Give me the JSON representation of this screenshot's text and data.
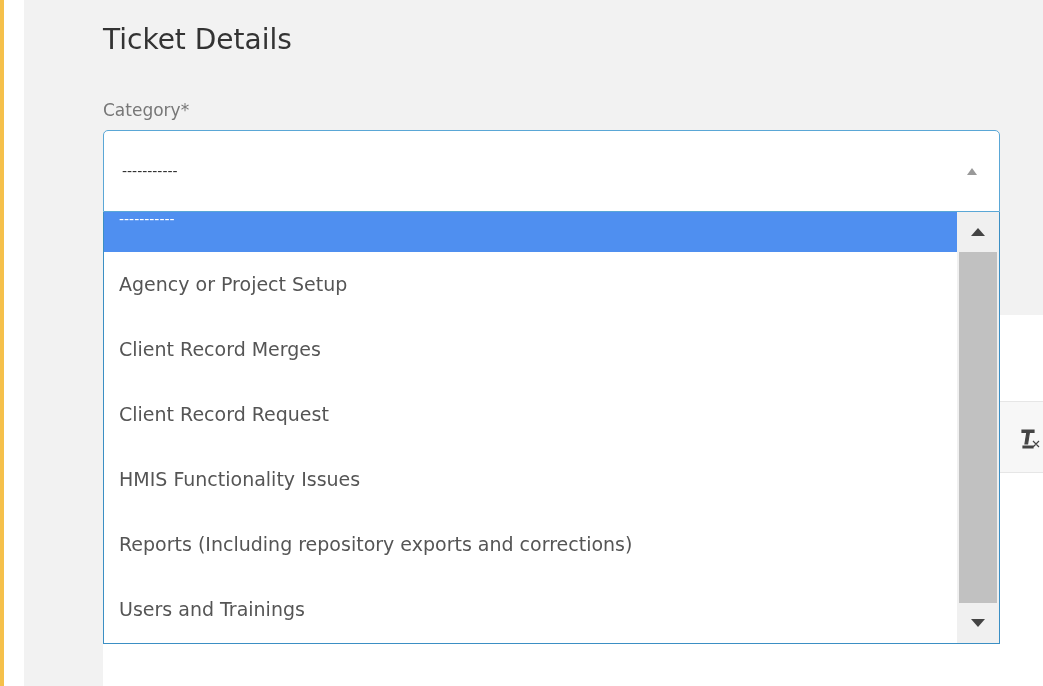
{
  "heading": "Ticket Details",
  "category": {
    "label": "Category*",
    "value": "-----------",
    "expanded": true,
    "options": [
      {
        "label": "-----------",
        "selected": true
      },
      {
        "label": "Agency or Project Setup",
        "selected": false
      },
      {
        "label": "Client Record Merges",
        "selected": false
      },
      {
        "label": "Client Record Request",
        "selected": false
      },
      {
        "label": "HMIS Functionality Issues",
        "selected": false
      },
      {
        "label": "Reports (Including repository exports and corrections)",
        "selected": false
      },
      {
        "label": "Users and Trainings",
        "selected": false
      }
    ]
  }
}
